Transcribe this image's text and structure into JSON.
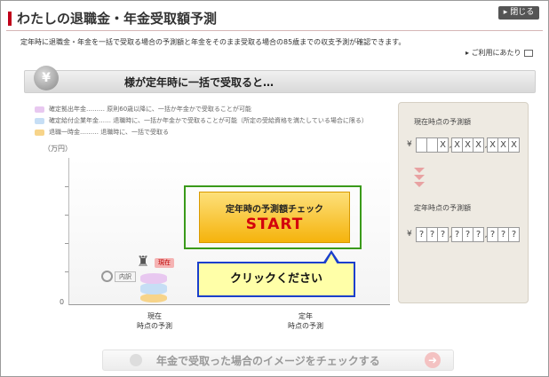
{
  "header": {
    "title": "わたしの退職金・年金受取額予測",
    "close_label": "閉じる",
    "description": "定年時に退職金・年金を一括で受取る場合の予測額と年金をそのまま受取る場合の85歳までの収支予測が確認できます。",
    "help_link": "ご利用にあたり"
  },
  "banner": {
    "text": "様が定年時に一括で受取ると…"
  },
  "legend": [
    {
      "name": "確定拠出年金",
      "desc": "原則60歳以降に、一括か年金かで受取ることが可能",
      "color": "#e8c8f0"
    },
    {
      "name": "確定給付企業年金",
      "desc": "退職時に、一括か年金かで受取ることが可能（所定の受給資格を満たしている場合に限る）",
      "color": "#c6def5"
    },
    {
      "name": "退職一時金",
      "desc": "退職時に、一括で受取る",
      "color": "#f7d48a"
    }
  ],
  "chart": {
    "y_unit": "（万円）",
    "zero_label": "0",
    "x_labels": [
      {
        "line1": "現在",
        "line2": "時点の予測"
      },
      {
        "line1": "定年",
        "line2": "時点の予測"
      }
    ],
    "now_badge": "現在",
    "naiyaku_label": "内訳"
  },
  "start_button": {
    "subtitle": "定年時の予測額チェック",
    "label": "START"
  },
  "callout": {
    "text": "クリックください"
  },
  "side_panel": {
    "current_label": "現在時点の予測額",
    "retire_label": "定年時点の予測額",
    "yen": "¥",
    "current_digits": [
      "",
      "",
      "X",
      "X",
      "X",
      "X",
      "X",
      "X",
      "X"
    ],
    "retire_digits": [
      "?",
      "?",
      "?",
      "?",
      "?",
      "?",
      "?",
      "?",
      "?"
    ]
  },
  "bottom_button": {
    "label": "年金で受取った場合のイメージをチェックする"
  }
}
